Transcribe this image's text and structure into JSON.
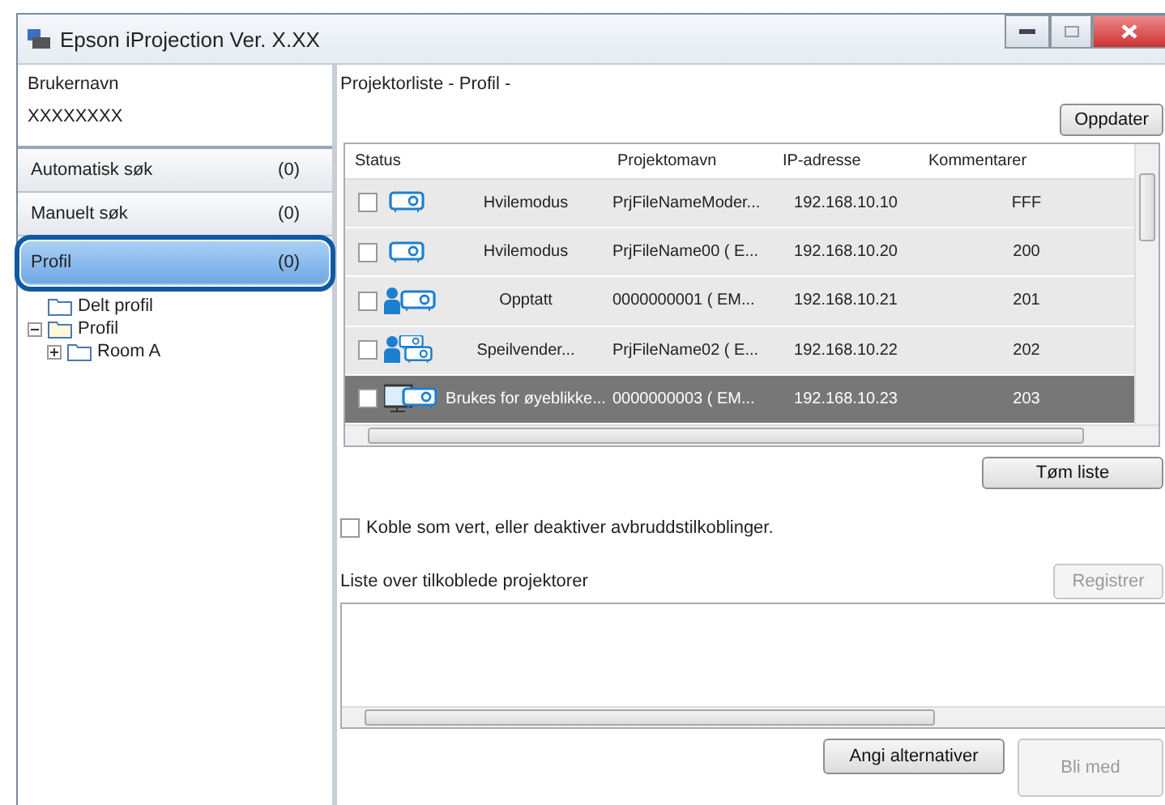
{
  "window": {
    "title": "Epson iProjection Ver. X.XX"
  },
  "user": {
    "label": "Brukernavn",
    "value": "XXXXXXXX"
  },
  "nav": [
    {
      "label": "Automatisk søk",
      "count": "(0)",
      "selected": false
    },
    {
      "label": "Manuelt søk",
      "count": "(0)",
      "selected": false
    },
    {
      "label": "Profil",
      "count": "(0)",
      "selected": true
    }
  ],
  "tree": [
    {
      "label": "Delt profil"
    },
    {
      "label": "Profil",
      "expanded": true,
      "children": [
        {
          "label": "Room A",
          "expanded": false
        }
      ]
    }
  ],
  "list_title": "Projektorliste - Profil -",
  "refresh_button": "Oppdater",
  "table": {
    "columns": [
      "Status",
      "Projektomavn",
      "IP-adresse",
      "Kommentarer"
    ],
    "rows": [
      {
        "kind": "projector",
        "checked": false,
        "selected": false,
        "status": "Hvilemodus",
        "name": "PrjFileNameModer...",
        "ip": "192.168.10.10",
        "comment": "FFF"
      },
      {
        "kind": "projector",
        "checked": false,
        "selected": false,
        "status": "Hvilemodus",
        "name": "PrjFileName00 ( E...",
        "ip": "192.168.10.20",
        "comment": "200"
      },
      {
        "kind": "user",
        "checked": false,
        "selected": false,
        "status": "Opptatt",
        "name": "0000000001 ( EM...",
        "ip": "192.168.10.21",
        "comment": "201"
      },
      {
        "kind": "mirror",
        "checked": false,
        "selected": false,
        "status": "Speilvender...",
        "name": "PrjFileName02 ( E...",
        "ip": "192.168.10.22",
        "comment": "202"
      },
      {
        "kind": "screen",
        "checked": false,
        "selected": true,
        "status": "Brukes for øyeblikke...",
        "name": "0000000003 ( EM...",
        "ip": "192.168.10.23",
        "comment": "203"
      }
    ]
  },
  "clear_button": "Tøm liste",
  "host_option": {
    "label": "Koble som vert, eller deaktiver avbruddstilkoblinger.",
    "checked": false
  },
  "connected_label": "Liste over tilkoblede projektorer",
  "register_button": {
    "label": "Registrer",
    "disabled": true
  },
  "options_button": {
    "label": "Angi alternativer",
    "disabled": false
  },
  "join_button": {
    "label": "Bli med",
    "disabled": true
  }
}
